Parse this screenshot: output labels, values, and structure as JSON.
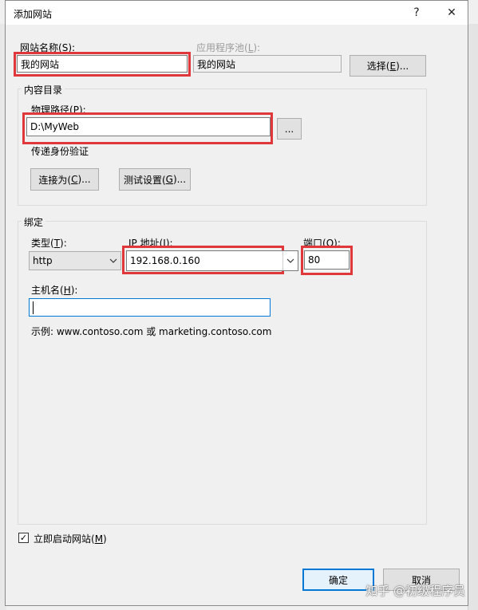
{
  "window": {
    "title": "添加网站",
    "help_glyph": "?",
    "close_glyph": "✕"
  },
  "site_name": {
    "label_prefix": "网站名称(",
    "label_key": "S",
    "label_suffix": "):",
    "value": "我的网站"
  },
  "app_pool": {
    "label_prefix": "应用程序池(",
    "label_key": "L",
    "label_suffix": "):",
    "value": "我的网站",
    "select_btn_prefix": "选择(",
    "select_btn_key": "E",
    "select_btn_suffix": ")..."
  },
  "content": {
    "group_title": "内容目录",
    "path_label_prefix": "物理路径(",
    "path_label_key": "P",
    "path_label_suffix": "):",
    "path_value": "D:\\MyWeb",
    "browse_label": "...",
    "auth_label": "传递身份验证",
    "connect_as_prefix": "连接为(",
    "connect_as_key": "C",
    "connect_as_suffix": ")...",
    "test_settings_prefix": "测试设置(",
    "test_settings_key": "G",
    "test_settings_suffix": ")..."
  },
  "binding": {
    "group_title": "绑定",
    "type_label_prefix": "类型(",
    "type_label_key": "T",
    "type_label_suffix": "):",
    "type_value": "http",
    "ip_label_prefix": "IP 地址(",
    "ip_label_key": "I",
    "ip_label_suffix": "):",
    "ip_value": "192.168.0.160",
    "port_label_prefix": "端口(",
    "port_label_key": "O",
    "port_label_suffix": "):",
    "port_value": "80",
    "host_label_prefix": "主机名(",
    "host_label_key": "H",
    "host_label_suffix": "):",
    "host_value": "",
    "example_text": "示例: www.contoso.com 或 marketing.contoso.com"
  },
  "start_now": {
    "checked": true,
    "check_glyph": "✓",
    "label_prefix": "立即启动网站(",
    "label_key": "M",
    "label_suffix": ")"
  },
  "footer": {
    "ok_label": "确定",
    "cancel_label": "取消"
  },
  "watermark": {
    "text": "知乎 @初级程序员"
  },
  "colors": {
    "highlight_red": "#e0383a",
    "focus_blue": "#0078d7"
  }
}
